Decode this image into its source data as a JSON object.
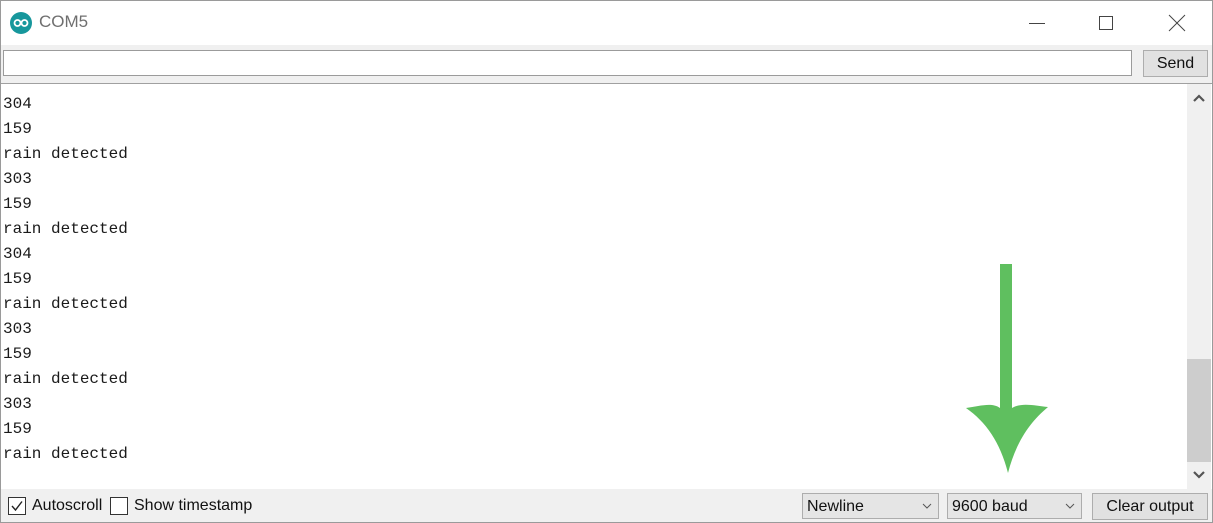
{
  "window": {
    "title": "COM5",
    "app_icon": "arduino-infinity-icon",
    "controls": [
      "minimize-icon",
      "maximize-icon",
      "close-icon"
    ]
  },
  "send_bar": {
    "input_value": "",
    "input_placeholder": "",
    "send_label": "Send"
  },
  "output": {
    "lines": [
      "304",
      "159",
      "rain detected",
      "303",
      "159",
      "rain detected",
      "304",
      "159",
      "rain detected",
      "303",
      "159",
      "rain detected",
      "303",
      "159",
      "rain detected"
    ]
  },
  "annotation": {
    "icon": "down-arrow-icon",
    "color": "#5fbf5f"
  },
  "bottom_bar": {
    "autoscroll": {
      "label": "Autoscroll",
      "checked": true
    },
    "show_timestamp": {
      "label": "Show timestamp",
      "checked": false
    },
    "line_ending": {
      "selected": "Newline"
    },
    "baud_rate": {
      "selected": "9600 baud"
    },
    "clear_label": "Clear output"
  },
  "colors": {
    "arduino_teal": "#17979c",
    "annotation_green": "#5fbf5f"
  }
}
